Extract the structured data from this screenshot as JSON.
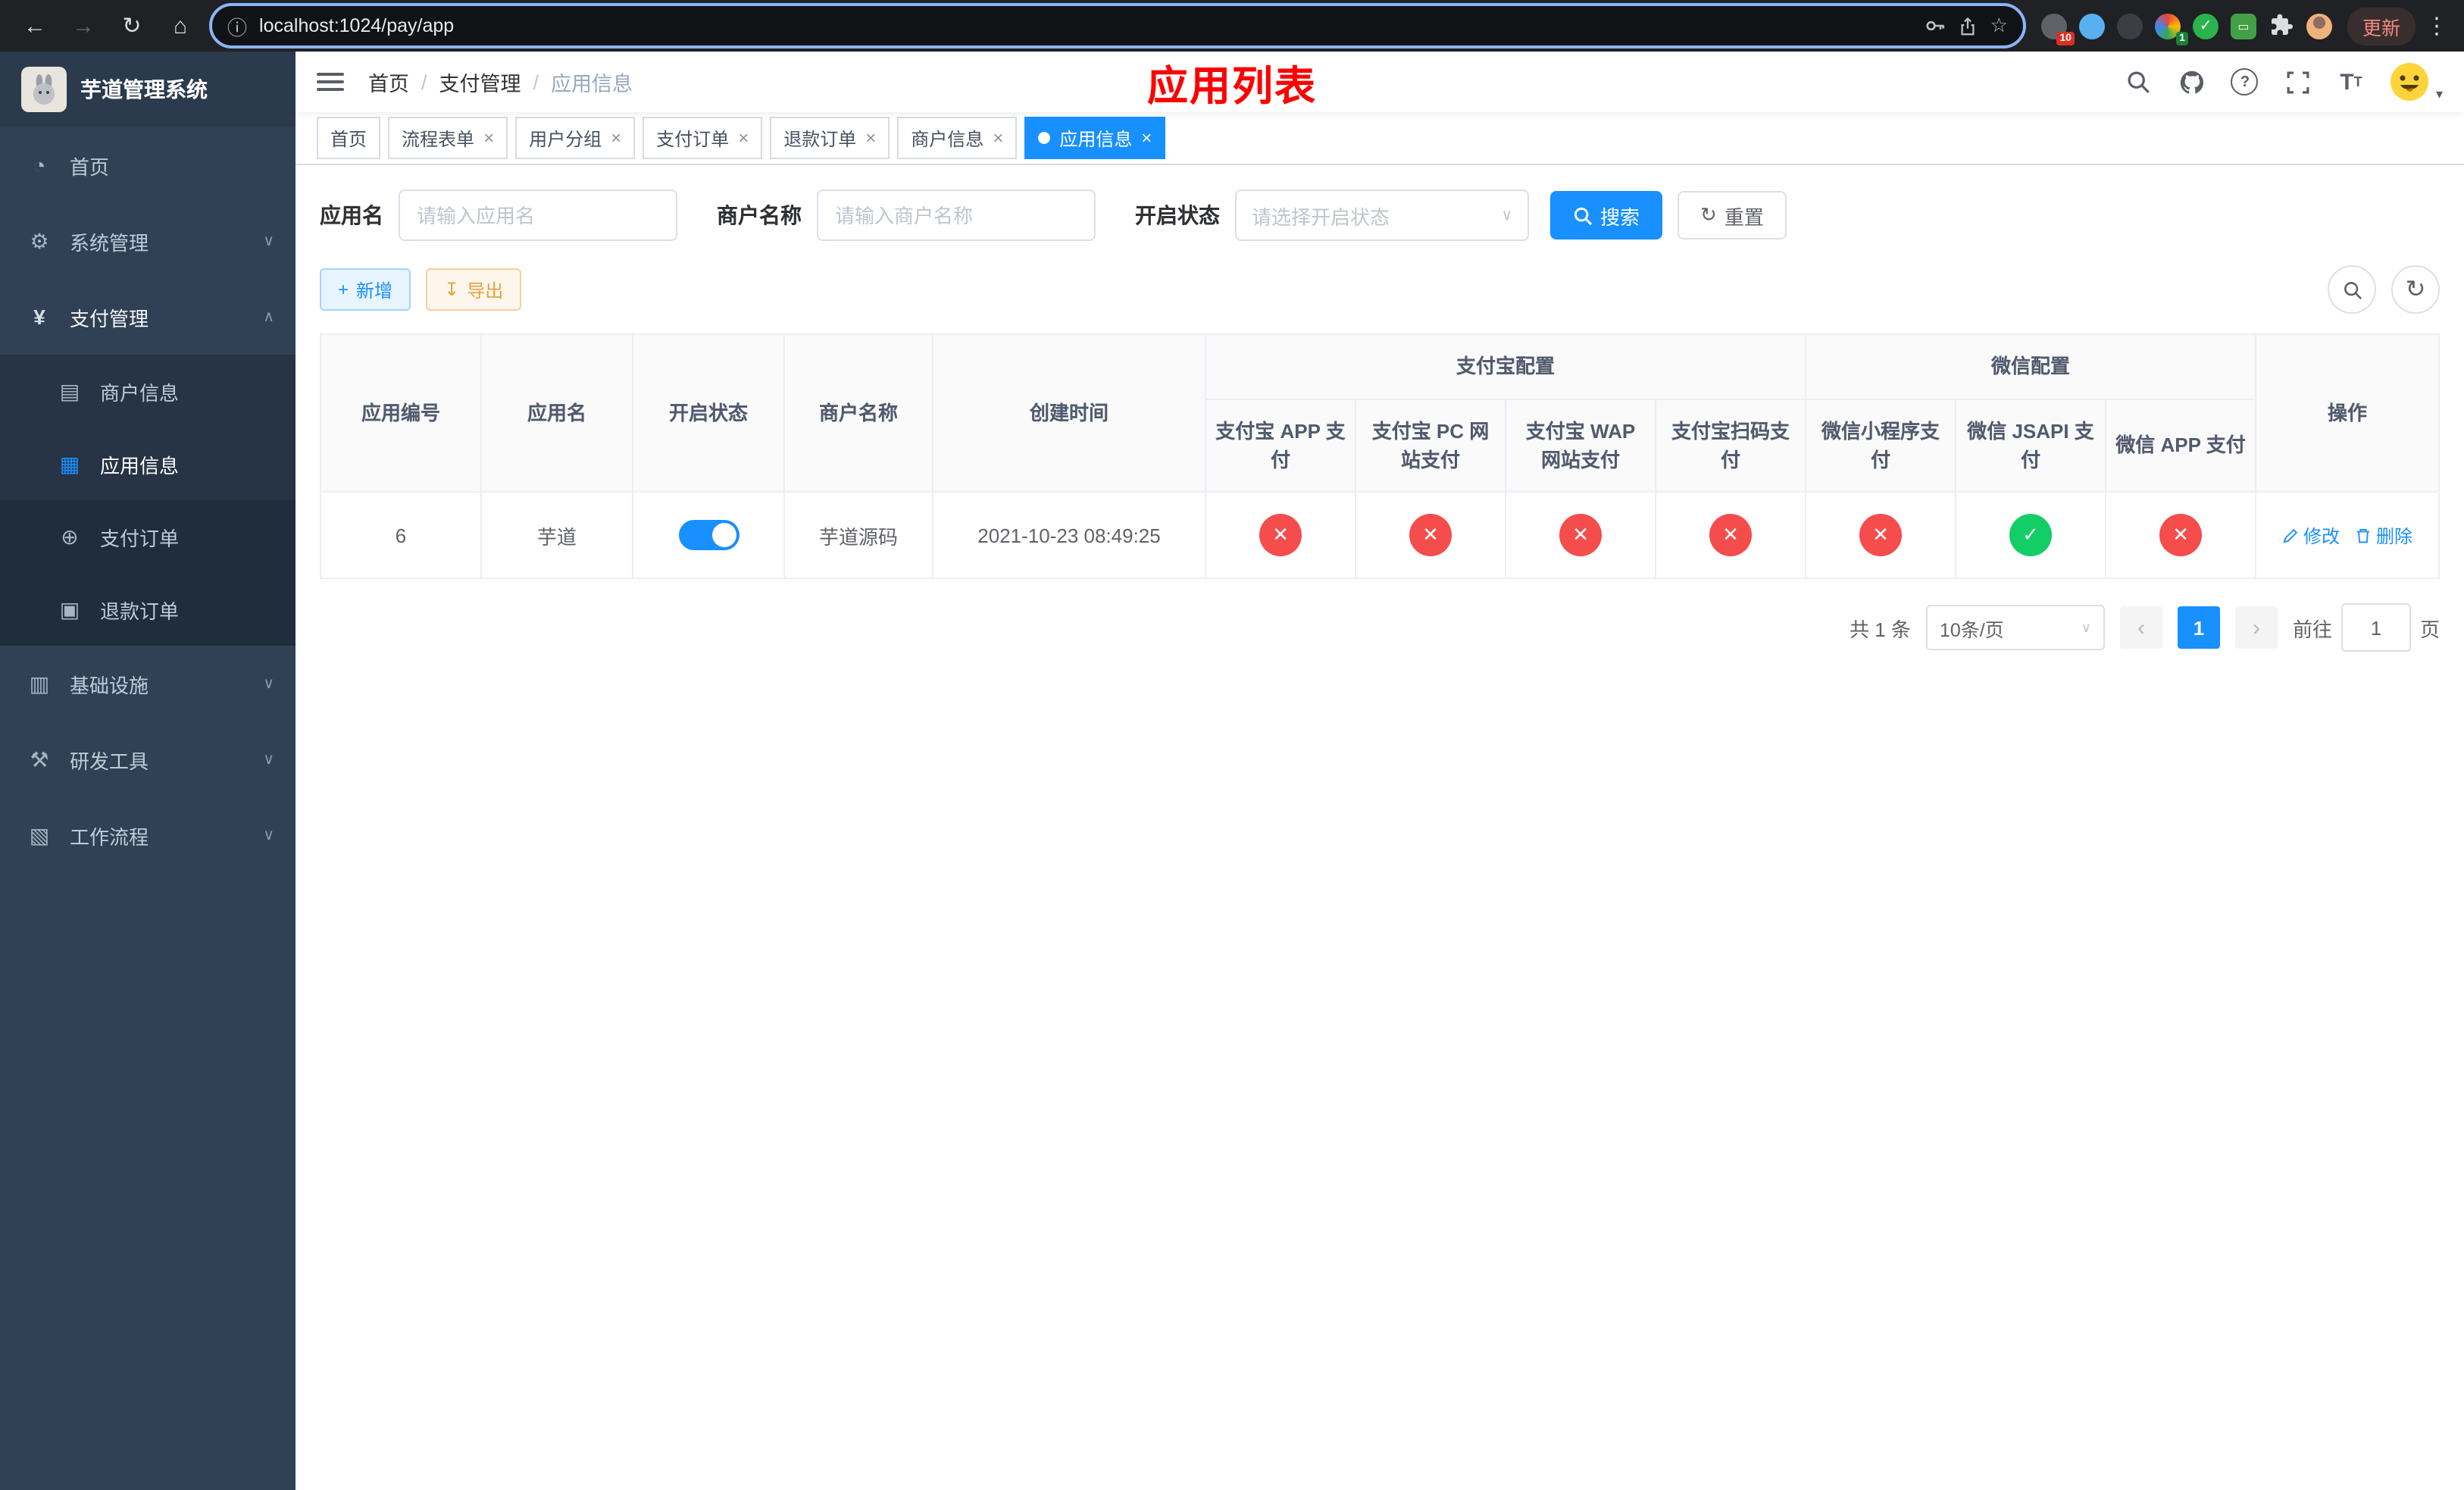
{
  "colors": {
    "accent": "#1890ff",
    "danger": "#f54c4c",
    "success": "#13ce66",
    "title_red": "#ff0000",
    "sidebar_bg": "#304156"
  },
  "browser": {
    "url": "localhost:1024/pay/app",
    "update_label": "更新",
    "extension_badges": {
      "first": "10",
      "second": "1"
    }
  },
  "icons": {
    "back": "←",
    "forward": "→",
    "reload": "↻",
    "home": "⌂",
    "info": "ⓘ",
    "star": "☆",
    "kebab": "⋮",
    "caret_down": "▾",
    "chevron_down": "∨",
    "chevron_up": "∧",
    "close": "×",
    "plus": "+",
    "download": "↧",
    "question": "?",
    "fail": "✕",
    "ok": "✓",
    "prev": "‹",
    "next": "›"
  },
  "sidebar": {
    "title": "芋道管理系统",
    "items": [
      {
        "label": "首页",
        "glyph": "◔"
      },
      {
        "label": "系统管理",
        "glyph": "⚙"
      },
      {
        "label": "支付管理",
        "glyph": "¥"
      },
      {
        "label": "基础设施",
        "glyph": "▥"
      },
      {
        "label": "研发工具",
        "glyph": "⚒"
      },
      {
        "label": "工作流程",
        "glyph": "▧"
      }
    ],
    "payment_children": [
      {
        "label": "商户信息",
        "glyph": "▤"
      },
      {
        "label": "应用信息",
        "glyph": "▦",
        "active": true
      },
      {
        "label": "支付订单",
        "glyph": "⊕"
      },
      {
        "label": "退款订单",
        "glyph": "▣"
      }
    ]
  },
  "header": {
    "breadcrumb": [
      "首页",
      "支付管理",
      "应用信息"
    ],
    "separator": "/",
    "page_title": "应用列表"
  },
  "tabs": [
    {
      "label": "首页",
      "closable": false
    },
    {
      "label": "流程表单",
      "closable": true
    },
    {
      "label": "用户分组",
      "closable": true
    },
    {
      "label": "支付订单",
      "closable": true
    },
    {
      "label": "退款订单",
      "closable": true
    },
    {
      "label": "商户信息",
      "closable": true
    },
    {
      "label": "应用信息",
      "closable": true,
      "active": true
    }
  ],
  "filters": {
    "app_name_label": "应用名",
    "app_name_placeholder": "请输入应用名",
    "merchant_label": "商户名称",
    "merchant_placeholder": "请输入商户名称",
    "status_label": "开启状态",
    "status_placeholder": "请选择开启状态",
    "search_label": "搜索",
    "reset_label": "重置"
  },
  "toolbar": {
    "add_label": "新增",
    "export_label": "导出"
  },
  "table": {
    "headers": {
      "app_id": "应用编号",
      "app_name": "应用名",
      "status": "开启状态",
      "merchant": "商户名称",
      "created": "创建时间",
      "ops": "操作",
      "alipay_group": "支付宝配置",
      "wechat_group": "微信配置"
    },
    "alipay_cols": [
      "支付宝 APP 支付",
      "支付宝 PC 网站支付",
      "支付宝 WAP 网站支付",
      "支付宝扫码支付"
    ],
    "wechat_cols": [
      "微信小程序支付",
      "微信 JSAPI 支付",
      "微信 APP 支付"
    ],
    "rows": [
      {
        "app_id": "6",
        "app_name": "芋道",
        "enabled": true,
        "merchant": "芋道源码",
        "created": "2021-10-23 08:49:25",
        "alipay_status": [
          false,
          false,
          false,
          false
        ],
        "wechat_status": [
          false,
          true,
          false
        ],
        "edit_label": "修改",
        "delete_label": "删除"
      }
    ]
  },
  "pagination": {
    "total": "共 1 条",
    "page_size": "10条/页",
    "page": "1",
    "goto_label": "前往",
    "goto_value": "1",
    "page_unit": "页"
  }
}
